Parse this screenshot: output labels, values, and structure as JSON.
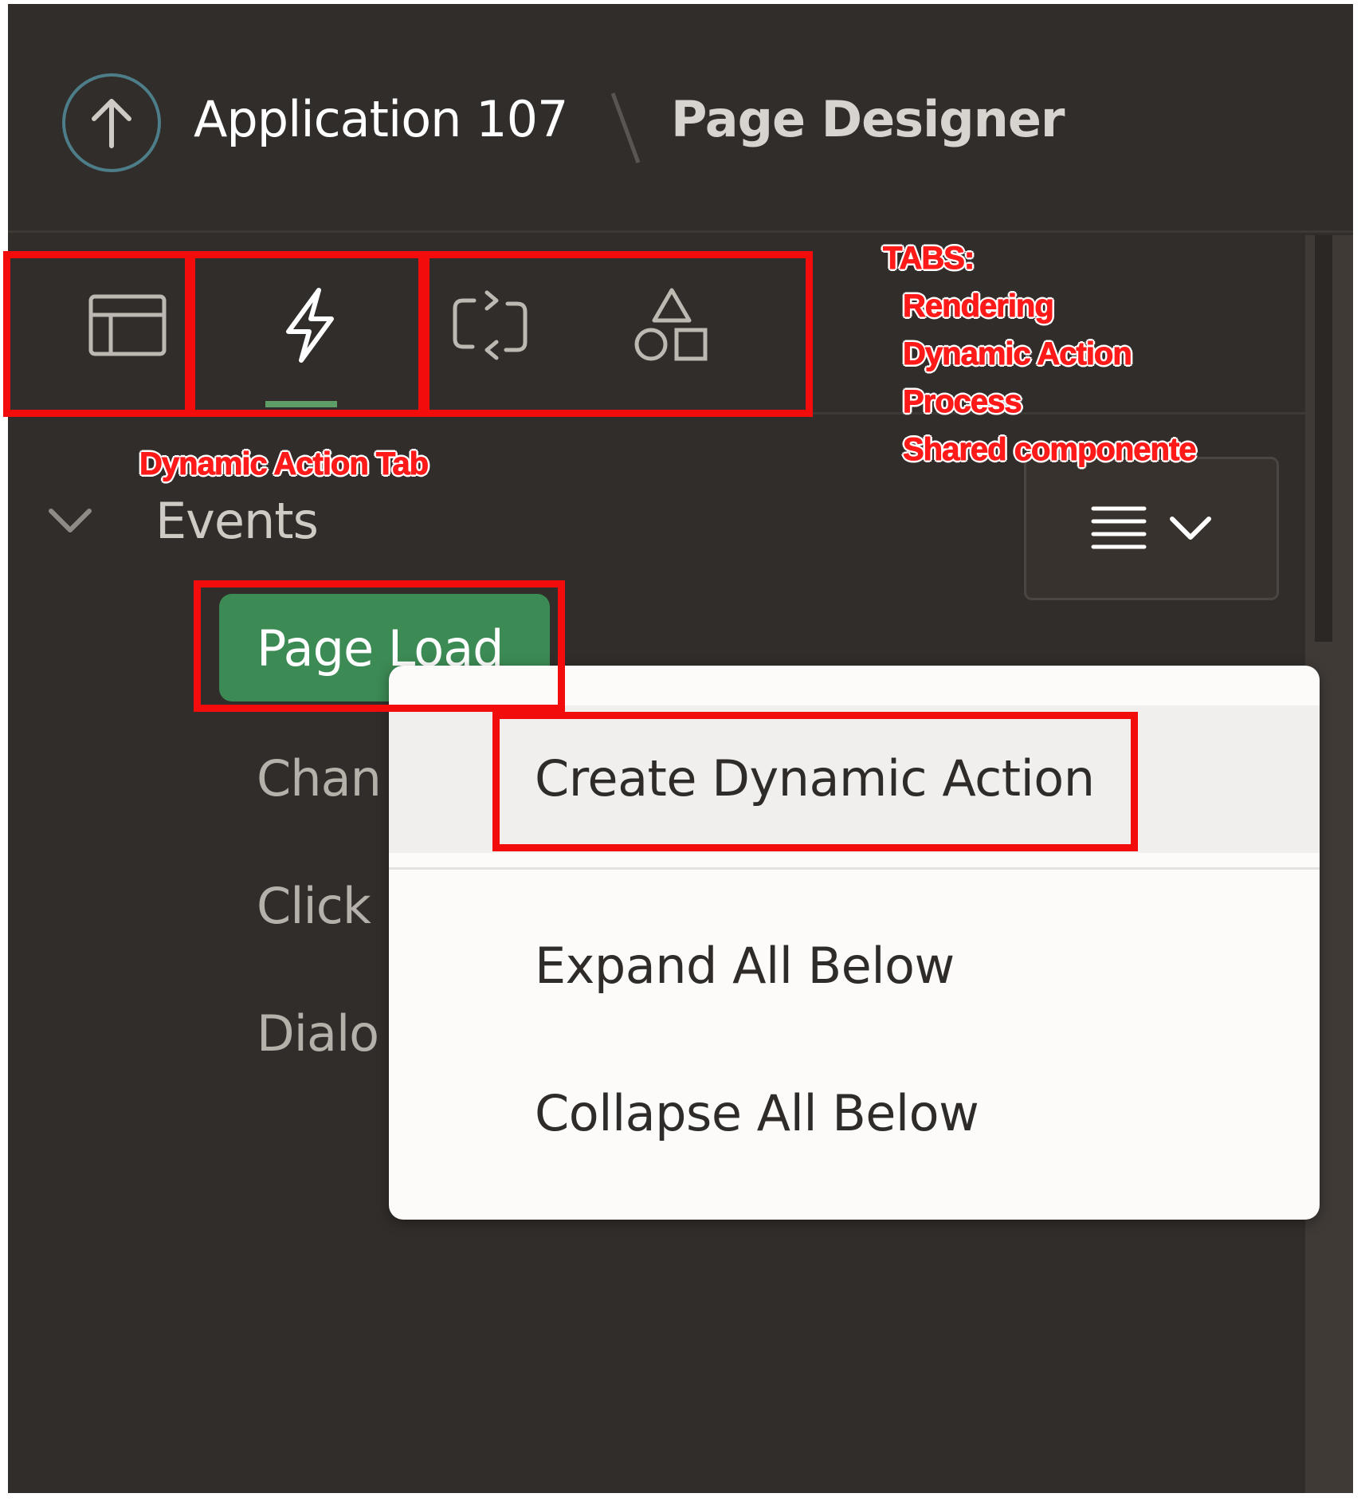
{
  "header": {
    "app_title": "Application 107",
    "page_title": "Page Designer",
    "up_icon": "arrow-up-icon"
  },
  "tabs": [
    {
      "icon": "rendering-icon",
      "active": false
    },
    {
      "icon": "lightning-icon",
      "active": true
    },
    {
      "icon": "process-cycle-icon",
      "active": false
    },
    {
      "icon": "shapes-icon",
      "active": false
    }
  ],
  "tree": {
    "root_label": "Events",
    "selected_node": "Page Load",
    "children": [
      "Chan",
      "Click",
      "Dialo"
    ]
  },
  "menu_button": {
    "icons": [
      "hamburger-icon",
      "chevron-down-icon"
    ]
  },
  "context_menu": {
    "items": [
      "Create Dynamic Action",
      "Expand All Below",
      "Collapse All Below"
    ]
  },
  "annotations": {
    "tabs_heading": "TABS:",
    "tab_names": [
      "Rendering",
      "Dynamic Action",
      "Process",
      "Shared componente"
    ],
    "dynamic_action_tab": "Dynamic Action Tab"
  },
  "colors": {
    "background": "#312d2a",
    "active_tab_indicator": "#5e9e66",
    "selected_node": "#3c8a54",
    "annotation_red": "#f20c0c",
    "up_button_ring": "#4c7d88"
  }
}
